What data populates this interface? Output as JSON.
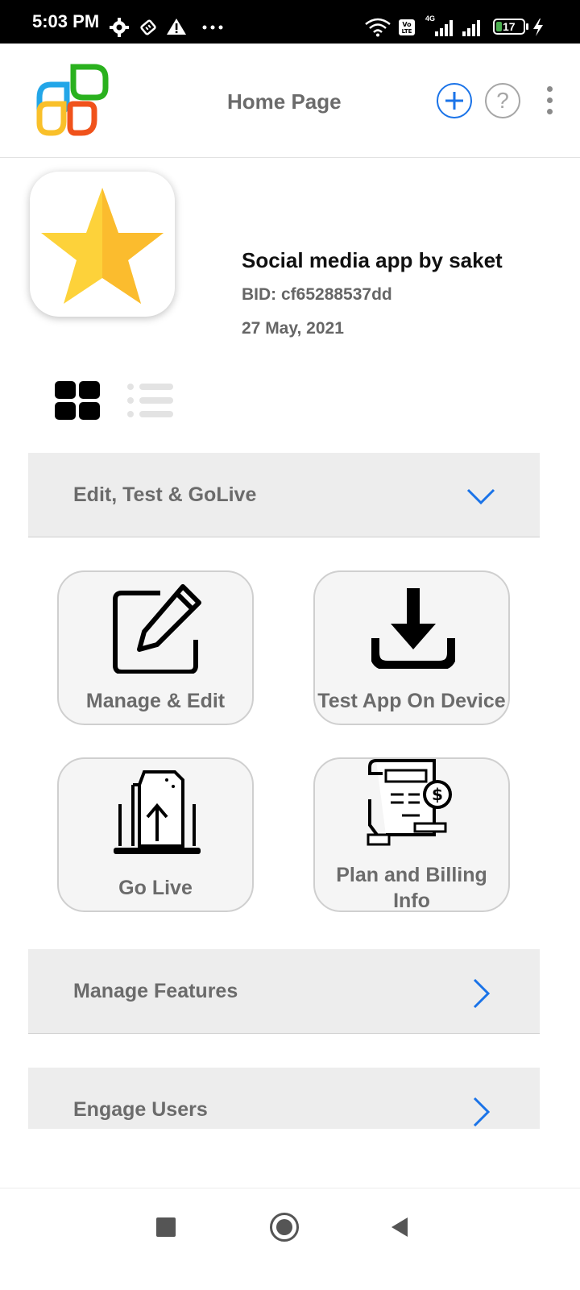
{
  "status_bar": {
    "time": "5:03 PM",
    "network": "4G",
    "battery": "17"
  },
  "header": {
    "title": "Home Page",
    "help_symbol": "?"
  },
  "app_info": {
    "name": "Social media app by saket",
    "bid": "BID: cf65288537dd",
    "date": "27 May, 2021"
  },
  "sections": {
    "edit_test_golive": "Edit, Test & GoLive",
    "manage_features": "Manage Features",
    "engage_users": "Engage Users"
  },
  "cards": {
    "manage_edit": "Manage & Edit",
    "test_app": "Test App On Device",
    "go_live": "Go Live",
    "plan_billing_line1": "Plan and Billing",
    "plan_billing_line2": "Info"
  },
  "colors": {
    "accent": "#1a73e8",
    "star": "#fcc02a",
    "section_bg": "#ededed",
    "card_bg": "#f5f5f5"
  },
  "icons": [
    "settings-icon",
    "sim-icon",
    "warning-icon",
    "wifi-icon",
    "volte-icon",
    "signal-icon",
    "battery-icon",
    "charging-icon",
    "app-logo-icon",
    "add-icon",
    "help-icon",
    "more-icon",
    "star-icon",
    "grid-view-icon",
    "list-view-icon",
    "chevron-down-icon",
    "chevron-right-icon",
    "edit-icon",
    "download-icon",
    "upload-laptop-icon",
    "billing-icon",
    "stop-icon",
    "home-icon",
    "back-icon"
  ]
}
